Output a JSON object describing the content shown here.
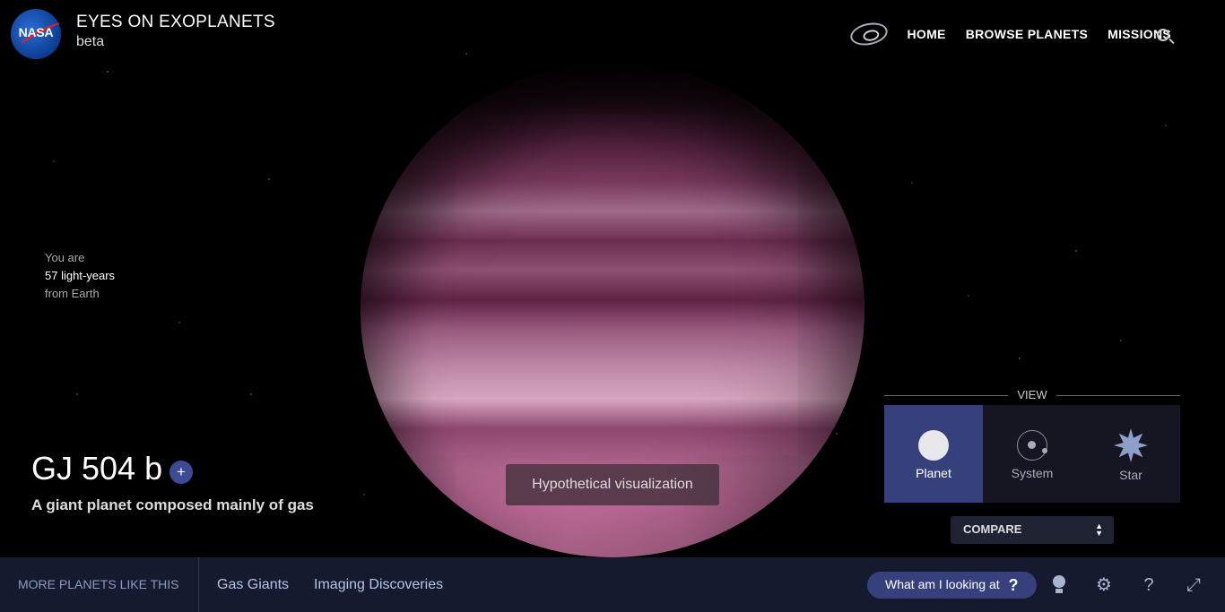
{
  "header": {
    "logo_text": "NASA",
    "title": "EYES ON EXOPLANETS",
    "subtitle": "beta",
    "nav": [
      {
        "label": "HOME"
      },
      {
        "label": "BROWSE PLANETS"
      },
      {
        "label": "MISSIONS"
      }
    ]
  },
  "distance": {
    "line1": "You are",
    "value": "57 light-years",
    "line3": "from Earth"
  },
  "planet": {
    "name": "GJ 504 b",
    "add_symbol": "+",
    "description": "A giant planet composed mainly of gas",
    "visualization_note": "Hypothetical visualization"
  },
  "view_panel": {
    "label": "VIEW",
    "options": [
      {
        "label": "Planet",
        "icon": "planet-icon",
        "active": true
      },
      {
        "label": "System",
        "icon": "system-icon",
        "active": false
      },
      {
        "label": "Star",
        "icon": "star-icon",
        "active": false
      }
    ],
    "compare_label": "COMPARE"
  },
  "bottom_bar": {
    "more_label": "MORE PLANETS LIKE THIS",
    "tags": [
      "Gas Giants",
      "Imaging Discoveries"
    ],
    "what_label": "What am I looking at",
    "what_symbol": "?"
  },
  "colors": {
    "accent": "#36407d",
    "bottom_bar": "#151a2e"
  }
}
